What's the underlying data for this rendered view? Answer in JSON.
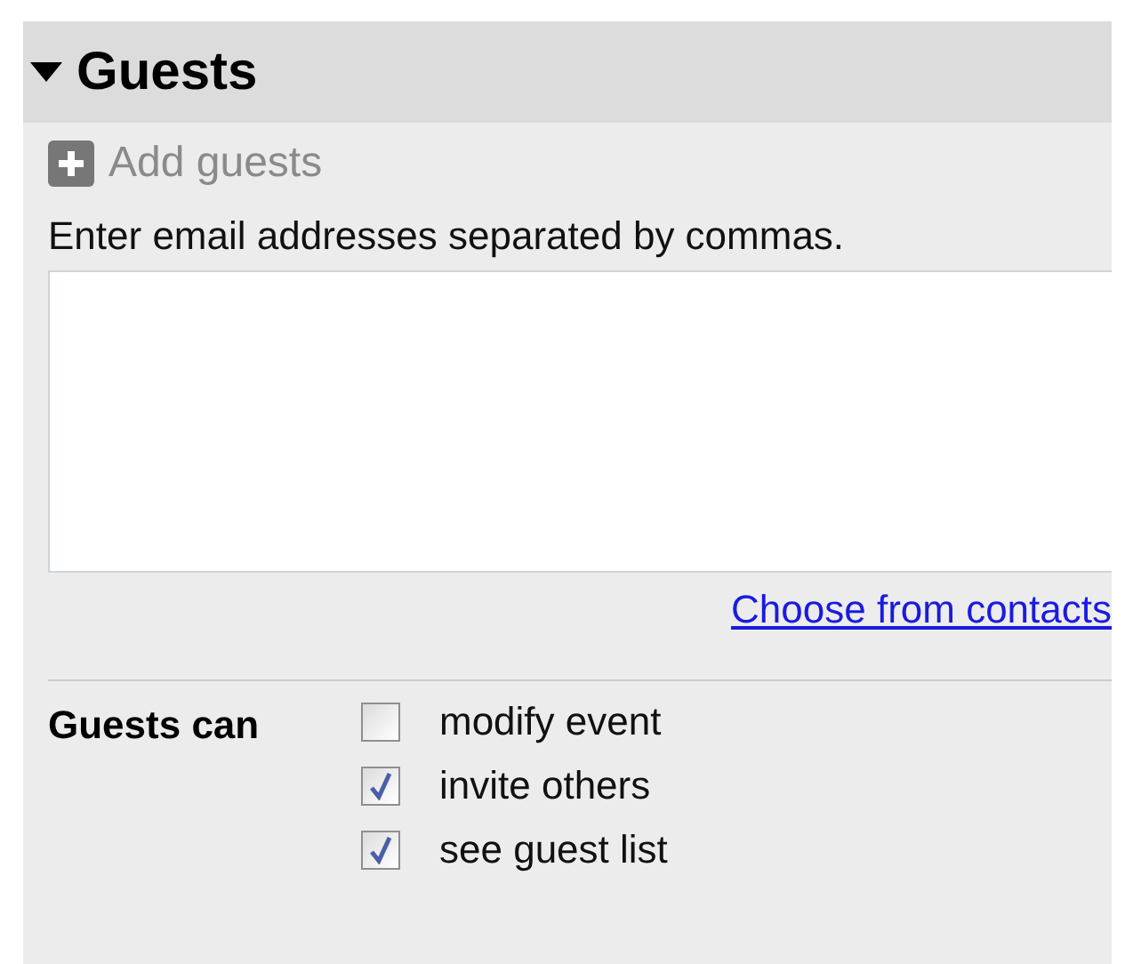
{
  "section": {
    "title": "Guests",
    "expanded": true
  },
  "add_guests": {
    "label": "Add guests"
  },
  "email": {
    "label": "Enter email addresses separated by commas."
  },
  "contacts_link": "Choose from contacts",
  "permissions": {
    "label": "Guests can",
    "options": [
      {
        "label": "modify event",
        "checked": false
      },
      {
        "label": "invite others",
        "checked": true
      },
      {
        "label": "see guest list",
        "checked": true
      }
    ]
  }
}
